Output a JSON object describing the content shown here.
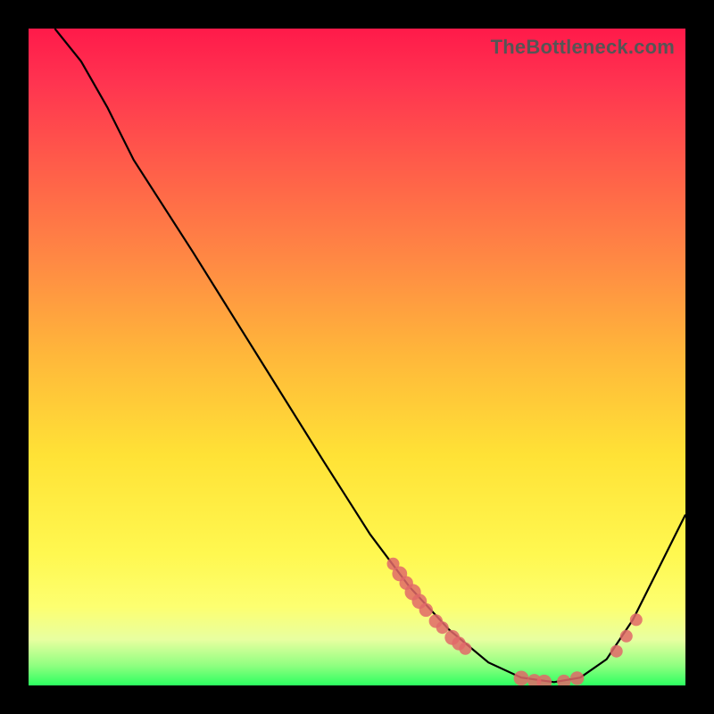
{
  "watermark": "TheBottleneck.com",
  "chart_data": {
    "type": "line",
    "title": "",
    "xlabel": "",
    "ylabel": "",
    "xlim": [
      0,
      100
    ],
    "ylim": [
      0,
      100
    ],
    "grid": false,
    "curve": [
      {
        "x": 4,
        "y": 100
      },
      {
        "x": 8,
        "y": 95
      },
      {
        "x": 12,
        "y": 88
      },
      {
        "x": 16,
        "y": 80
      },
      {
        "x": 25,
        "y": 66
      },
      {
        "x": 35,
        "y": 50
      },
      {
        "x": 45,
        "y": 34
      },
      {
        "x": 52,
        "y": 23
      },
      {
        "x": 58,
        "y": 15
      },
      {
        "x": 64,
        "y": 8.5
      },
      {
        "x": 70,
        "y": 3.5
      },
      {
        "x": 75,
        "y": 1.2
      },
      {
        "x": 80,
        "y": 0.5
      },
      {
        "x": 84,
        "y": 1.2
      },
      {
        "x": 88,
        "y": 4
      },
      {
        "x": 92,
        "y": 10
      },
      {
        "x": 96,
        "y": 18
      },
      {
        "x": 100,
        "y": 26
      }
    ],
    "markers": [
      {
        "x": 55.5,
        "y": 18.5,
        "r": 1.0
      },
      {
        "x": 56.5,
        "y": 17.0,
        "r": 1.2
      },
      {
        "x": 57.5,
        "y": 15.6,
        "r": 1.1
      },
      {
        "x": 58.5,
        "y": 14.2,
        "r": 1.3
      },
      {
        "x": 59.5,
        "y": 12.8,
        "r": 1.2
      },
      {
        "x": 60.5,
        "y": 11.5,
        "r": 1.1
      },
      {
        "x": 62.0,
        "y": 9.8,
        "r": 1.1
      },
      {
        "x": 63.0,
        "y": 8.8,
        "r": 1.0
      },
      {
        "x": 64.5,
        "y": 7.3,
        "r": 1.2
      },
      {
        "x": 65.5,
        "y": 6.4,
        "r": 1.1
      },
      {
        "x": 66.5,
        "y": 5.6,
        "r": 1.0
      },
      {
        "x": 75.0,
        "y": 1.1,
        "r": 1.2
      },
      {
        "x": 77.0,
        "y": 0.7,
        "r": 1.1
      },
      {
        "x": 78.5,
        "y": 0.5,
        "r": 1.2
      },
      {
        "x": 81.5,
        "y": 0.6,
        "r": 1.1
      },
      {
        "x": 83.5,
        "y": 1.1,
        "r": 1.1
      },
      {
        "x": 89.5,
        "y": 5.2,
        "r": 1.0
      },
      {
        "x": 91.0,
        "y": 7.5,
        "r": 1.0
      },
      {
        "x": 92.5,
        "y": 10.0,
        "r": 1.0
      }
    ],
    "colors": {
      "curve": "#000000",
      "markers": "#e06868",
      "gradient_top": "#ff1a4a",
      "gradient_bottom": "#2cff60"
    }
  }
}
